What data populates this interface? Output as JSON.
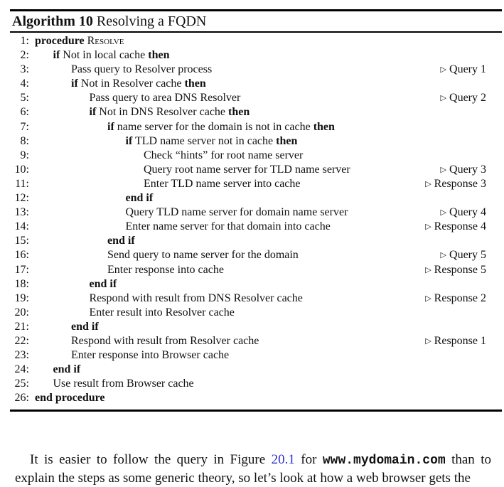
{
  "algorithm": {
    "label": "Algorithm 10",
    "title": "Resolving a FQDN",
    "lines": [
      {
        "n": "1:",
        "indent": 0,
        "parts": [
          {
            "t": "procedure",
            "kw": true
          },
          {
            "t": " "
          },
          {
            "t": "Resolve",
            "sc": true
          }
        ],
        "comment": ""
      },
      {
        "n": "2:",
        "indent": 1,
        "parts": [
          {
            "t": "if",
            "kw": true
          },
          {
            "t": " Not in local cache "
          },
          {
            "t": "then",
            "kw": true
          }
        ],
        "comment": ""
      },
      {
        "n": "3:",
        "indent": 2,
        "parts": [
          {
            "t": "Pass query to Resolver process"
          }
        ],
        "comment": "Query 1"
      },
      {
        "n": "4:",
        "indent": 2,
        "parts": [
          {
            "t": "if",
            "kw": true
          },
          {
            "t": " Not in Resolver cache "
          },
          {
            "t": "then",
            "kw": true
          }
        ],
        "comment": ""
      },
      {
        "n": "5:",
        "indent": 3,
        "parts": [
          {
            "t": "Pass query to area DNS Resolver"
          }
        ],
        "comment": "Query 2"
      },
      {
        "n": "6:",
        "indent": 3,
        "parts": [
          {
            "t": "if",
            "kw": true
          },
          {
            "t": " Not in DNS Resolver cache "
          },
          {
            "t": "then",
            "kw": true
          }
        ],
        "comment": ""
      },
      {
        "n": "7:",
        "indent": 4,
        "parts": [
          {
            "t": "if",
            "kw": true
          },
          {
            "t": " name server for the domain is not in cache "
          },
          {
            "t": "then",
            "kw": true
          }
        ],
        "comment": ""
      },
      {
        "n": "8:",
        "indent": 5,
        "parts": [
          {
            "t": "if",
            "kw": true
          },
          {
            "t": " TLD name server not in cache "
          },
          {
            "t": "then",
            "kw": true
          }
        ],
        "comment": ""
      },
      {
        "n": "9:",
        "indent": 6,
        "parts": [
          {
            "t": "Check “hints” for root name server"
          }
        ],
        "comment": ""
      },
      {
        "n": "10:",
        "indent": 6,
        "parts": [
          {
            "t": "Query root name server for TLD name server"
          }
        ],
        "comment": "Query 3"
      },
      {
        "n": "11:",
        "indent": 6,
        "parts": [
          {
            "t": "Enter TLD name server into cache"
          }
        ],
        "comment": "Response 3"
      },
      {
        "n": "12:",
        "indent": 5,
        "parts": [
          {
            "t": "end if",
            "kw": true
          }
        ],
        "comment": ""
      },
      {
        "n": "13:",
        "indent": 5,
        "parts": [
          {
            "t": "Query TLD name server for domain name server"
          }
        ],
        "comment": "Query 4"
      },
      {
        "n": "14:",
        "indent": 5,
        "parts": [
          {
            "t": "Enter name server for that domain into cache"
          }
        ],
        "comment": "Response 4"
      },
      {
        "n": "15:",
        "indent": 4,
        "parts": [
          {
            "t": "end if",
            "kw": true
          }
        ],
        "comment": ""
      },
      {
        "n": "16:",
        "indent": 4,
        "parts": [
          {
            "t": "Send query to name server for the domain"
          }
        ],
        "comment": "Query 5"
      },
      {
        "n": "17:",
        "indent": 4,
        "parts": [
          {
            "t": "Enter response into cache"
          }
        ],
        "comment": "Response 5"
      },
      {
        "n": "18:",
        "indent": 3,
        "parts": [
          {
            "t": "end if",
            "kw": true
          }
        ],
        "comment": ""
      },
      {
        "n": "19:",
        "indent": 3,
        "parts": [
          {
            "t": "Respond with result from DNS Resolver cache"
          }
        ],
        "comment": "Response 2"
      },
      {
        "n": "20:",
        "indent": 3,
        "parts": [
          {
            "t": "Enter result into Resolver cache"
          }
        ],
        "comment": ""
      },
      {
        "n": "21:",
        "indent": 2,
        "parts": [
          {
            "t": "end if",
            "kw": true
          }
        ],
        "comment": ""
      },
      {
        "n": "22:",
        "indent": 2,
        "parts": [
          {
            "t": "Respond with result from Resolver cache"
          }
        ],
        "comment": "Response 1"
      },
      {
        "n": "23:",
        "indent": 2,
        "parts": [
          {
            "t": "Enter response into Browser cache"
          }
        ],
        "comment": ""
      },
      {
        "n": "24:",
        "indent": 1,
        "parts": [
          {
            "t": "end if",
            "kw": true
          }
        ],
        "comment": ""
      },
      {
        "n": "25:",
        "indent": 1,
        "parts": [
          {
            "t": "Use result from Browser cache"
          }
        ],
        "comment": ""
      },
      {
        "n": "26:",
        "indent": 0,
        "parts": [
          {
            "t": "end procedure",
            "kw": true
          }
        ],
        "comment": ""
      }
    ],
    "comment_marker": "▷"
  },
  "paragraph": {
    "text_1": "It is easier to follow the query in Figure ",
    "figure_ref": "20.1",
    "text_2": " for ",
    "code": "www.mydomain.com",
    "text_3": " than to explain the steps as some generic theory, so let’s look at how a web browser gets the"
  },
  "colors": {
    "link": "#2e2ecf",
    "text": "#111111"
  }
}
